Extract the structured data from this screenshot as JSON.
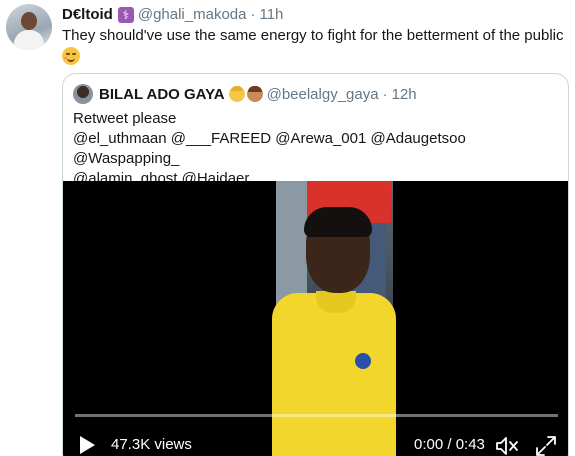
{
  "tweet": {
    "author_name": "D€ltoid",
    "badge_icon": "medical-symbol-icon",
    "handle": "@ghali_makoda",
    "separator": "·",
    "time": "11h",
    "text": "They should've use the same energy to fight for the betterment of the public",
    "emoji_icon": "smirking-face-emoji"
  },
  "quote": {
    "author_name": "BILAL ADO GAYA",
    "emoji_icons": [
      "blond-person-emoji",
      "man-beard-emoji"
    ],
    "handle": "@beelalgy_gaya",
    "separator": "·",
    "time": "12h",
    "text_line1": "Retweet please",
    "text_line2": "@el_uthmaan @___FAREED @Arewa_001 @Adaugetsoo @Waspapping_",
    "text_line3": "@alamin_ghost @Haidaer__",
    "video": {
      "views": "47.3K views",
      "timecode": "0:00 / 0:43",
      "progress": 0,
      "play_icon": "play-icon",
      "mute_icon": "mute-icon",
      "expand_icon": "expand-icon"
    }
  }
}
